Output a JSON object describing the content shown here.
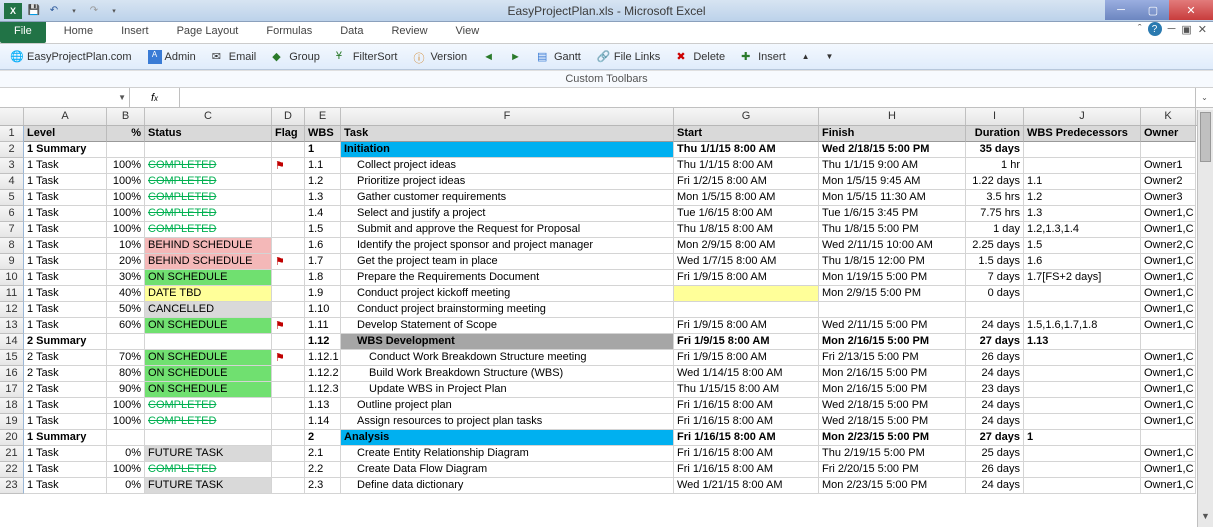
{
  "window": {
    "title": "EasyProjectPlan.xls  -  Microsoft Excel"
  },
  "ribbon": {
    "tabs": [
      "File",
      "Home",
      "Insert",
      "Page Layout",
      "Formulas",
      "Data",
      "Review",
      "View"
    ]
  },
  "toolbar": {
    "site": "EasyProjectPlan.com",
    "items": [
      "Admin",
      "Email",
      "Group",
      "FilterSort",
      "Version",
      "Gantt",
      "File Links",
      "Delete",
      "Insert"
    ],
    "label": "Custom Toolbars"
  },
  "namebox": "",
  "columns": [
    {
      "letter": "A",
      "cls": "cA"
    },
    {
      "letter": "B",
      "cls": "cB"
    },
    {
      "letter": "C",
      "cls": "cC"
    },
    {
      "letter": "D",
      "cls": "cD"
    },
    {
      "letter": "E",
      "cls": "cE"
    },
    {
      "letter": "F",
      "cls": "cF"
    },
    {
      "letter": "G",
      "cls": "cG"
    },
    {
      "letter": "H",
      "cls": "cH"
    },
    {
      "letter": "I",
      "cls": "cI"
    },
    {
      "letter": "J",
      "cls": "cJ"
    },
    {
      "letter": "K",
      "cls": "cK"
    }
  ],
  "headers": {
    "A": "Level",
    "B": "%",
    "C": "Status",
    "D": "Flag",
    "E": "WBS",
    "F": "Task",
    "G": "Start",
    "H": "Finish",
    "I": "Duration",
    "J": "WBS Predecessors",
    "K": "Owner"
  },
  "rows": [
    {
      "n": 2,
      "A": "1 Summary",
      "B": "",
      "C": "",
      "D": "",
      "E": "1",
      "F": "Initiation",
      "G": "Thu 1/1/15 8:00 AM",
      "H": "Wed 2/18/15 5:00 PM",
      "I": "35 days",
      "J": "",
      "K": "",
      "cls": "summary-row hl-initiation bold-dates"
    },
    {
      "n": 3,
      "A": "1 Task",
      "B": "100%",
      "C": "COMPLETED",
      "D": "flag",
      "E": "1.1",
      "F": "Collect project ideas",
      "G": "Thu 1/1/15 8:00 AM",
      "H": "Thu 1/1/15 9:00 AM",
      "I": "1 hr",
      "J": "",
      "K": "Owner1",
      "indent": 1,
      "status": "completed"
    },
    {
      "n": 4,
      "A": "1 Task",
      "B": "100%",
      "C": "COMPLETED",
      "D": "",
      "E": "1.2",
      "F": "Prioritize project ideas",
      "G": "Fri 1/2/15 8:00 AM",
      "H": "Mon 1/5/15 9:45 AM",
      "I": "1.22 days",
      "J": "1.1",
      "K": "Owner2",
      "indent": 1,
      "status": "completed"
    },
    {
      "n": 5,
      "A": "1 Task",
      "B": "100%",
      "C": "COMPLETED",
      "D": "",
      "E": "1.3",
      "F": "Gather customer requirements",
      "G": "Mon 1/5/15 8:00 AM",
      "H": "Mon 1/5/15 11:30 AM",
      "I": "3.5 hrs",
      "J": "1.2",
      "K": "Owner3",
      "indent": 1,
      "status": "completed"
    },
    {
      "n": 6,
      "A": "1 Task",
      "B": "100%",
      "C": "COMPLETED",
      "D": "",
      "E": "1.4",
      "F": "Select and justify a project",
      "G": "Tue 1/6/15 8:00 AM",
      "H": "Tue 1/6/15 3:45 PM",
      "I": "7.75 hrs",
      "J": "1.3",
      "K": "Owner1,C",
      "indent": 1,
      "status": "completed"
    },
    {
      "n": 7,
      "A": "1 Task",
      "B": "100%",
      "C": "COMPLETED",
      "D": "",
      "E": "1.5",
      "F": "Submit and approve the Request for Proposal",
      "G": "Thu 1/8/15 8:00 AM",
      "H": "Thu 1/8/15 5:00 PM",
      "I": "1 day",
      "J": "1.2,1.3,1.4",
      "K": "Owner1,C",
      "indent": 1,
      "status": "completed"
    },
    {
      "n": 8,
      "A": "1 Task",
      "B": "10%",
      "C": "BEHIND SCHEDULE",
      "D": "",
      "E": "1.6",
      "F": "Identify the project sponsor and project manager",
      "G": "Mon 2/9/15 8:00 AM",
      "H": "Wed 2/11/15 10:00 AM",
      "I": "2.25 days",
      "J": "1.5",
      "K": "Owner2,C",
      "indent": 1,
      "status": "behind"
    },
    {
      "n": 9,
      "A": "1 Task",
      "B": "20%",
      "C": "BEHIND SCHEDULE",
      "D": "flag",
      "E": "1.7",
      "F": "Get the project team in place",
      "G": "Wed 1/7/15 8:00 AM",
      "H": "Thu 1/8/15 12:00 PM",
      "I": "1.5 days",
      "J": "1.6",
      "K": "Owner1,C",
      "indent": 1,
      "status": "behind"
    },
    {
      "n": 10,
      "A": "1 Task",
      "B": "30%",
      "C": "ON SCHEDULE",
      "D": "",
      "E": "1.8",
      "F": "Prepare the Requirements Document",
      "G": "Fri 1/9/15 8:00 AM",
      "H": "Mon 1/19/15 5:00 PM",
      "I": "7 days",
      "J": "1.7[FS+2 days]",
      "K": "Owner1,C",
      "indent": 1,
      "status": "onsched"
    },
    {
      "n": 11,
      "A": "1 Task",
      "B": "40%",
      "C": "DATE TBD",
      "D": "",
      "E": "1.9",
      "F": "Conduct project kickoff meeting",
      "G": "",
      "H": "Mon 2/9/15 5:00 PM",
      "I": "0 days",
      "J": "",
      "K": "Owner1,C",
      "indent": 1,
      "status": "datetbd",
      "startYellow": true
    },
    {
      "n": 12,
      "A": "1 Task",
      "B": "50%",
      "C": "CANCELLED",
      "D": "",
      "E": "1.10",
      "F": "Conduct project brainstorming meeting",
      "G": "",
      "H": "",
      "I": "",
      "J": "",
      "K": "Owner1,C",
      "indent": 1,
      "status": "cancelled"
    },
    {
      "n": 13,
      "A": "1 Task",
      "B": "60%",
      "C": "ON SCHEDULE",
      "D": "flag",
      "E": "1.11",
      "F": "Develop Statement of Scope",
      "G": "Fri 1/9/15 8:00 AM",
      "H": "Wed 2/11/15 5:00 PM",
      "I": "24 days",
      "J": "1.5,1.6,1.7,1.8",
      "K": "Owner1,C",
      "indent": 1,
      "status": "onsched"
    },
    {
      "n": 14,
      "A": "2 Summary",
      "B": "",
      "C": "",
      "D": "",
      "E": "1.12",
      "F": "WBS Development",
      "G": "Fri 1/9/15 8:00 AM",
      "H": "Mon 2/16/15 5:00 PM",
      "I": "27 days",
      "J": "1.13",
      "K": "",
      "cls": "summary-row hl-wbs bold-dates",
      "findent": 1
    },
    {
      "n": 15,
      "A": "2 Task",
      "B": "70%",
      "C": "ON SCHEDULE",
      "D": "flag",
      "E": "1.12.1",
      "F": "Conduct Work Breakdown Structure meeting",
      "G": "Fri 1/9/15 8:00 AM",
      "H": "Fri 2/13/15 5:00 PM",
      "I": "26 days",
      "J": "",
      "K": "Owner1,C",
      "indent": 2,
      "status": "onsched"
    },
    {
      "n": 16,
      "A": "2 Task",
      "B": "80%",
      "C": "ON SCHEDULE",
      "D": "",
      "E": "1.12.2",
      "F": "Build Work Breakdown Structure (WBS)",
      "G": "Wed 1/14/15 8:00 AM",
      "H": "Mon 2/16/15 5:00 PM",
      "I": "24 days",
      "J": "",
      "K": "Owner1,C",
      "indent": 2,
      "status": "onsched"
    },
    {
      "n": 17,
      "A": "2 Task",
      "B": "90%",
      "C": "ON SCHEDULE",
      "D": "",
      "E": "1.12.3",
      "F": "Update WBS in Project Plan",
      "G": "Thu 1/15/15 8:00 AM",
      "H": "Mon 2/16/15 5:00 PM",
      "I": "23 days",
      "J": "",
      "K": "Owner1,C",
      "indent": 2,
      "status": "onsched"
    },
    {
      "n": 18,
      "A": "1 Task",
      "B": "100%",
      "C": "COMPLETED",
      "D": "",
      "E": "1.13",
      "F": "Outline project plan",
      "G": "Fri 1/16/15 8:00 AM",
      "H": "Wed 2/18/15 5:00 PM",
      "I": "24 days",
      "J": "",
      "K": "Owner1,C",
      "indent": 1,
      "status": "completed"
    },
    {
      "n": 19,
      "A": "1 Task",
      "B": "100%",
      "C": "COMPLETED",
      "D": "",
      "E": "1.14",
      "F": "Assign resources to project plan tasks",
      "G": "Fri 1/16/15 8:00 AM",
      "H": "Wed 2/18/15 5:00 PM",
      "I": "24 days",
      "J": "",
      "K": "Owner1,C",
      "indent": 1,
      "status": "completed"
    },
    {
      "n": 20,
      "A": "1 Summary",
      "B": "",
      "C": "",
      "D": "",
      "E": "2",
      "F": "Analysis",
      "G": "Fri 1/16/15 8:00 AM",
      "H": "Mon 2/23/15 5:00 PM",
      "I": "27 days",
      "J": "1",
      "K": "",
      "cls": "summary-row hl-analysis bold-dates"
    },
    {
      "n": 21,
      "A": "1 Task",
      "B": "0%",
      "C": "FUTURE TASK",
      "D": "",
      "E": "2.1",
      "F": "Create Entity Relationship Diagram",
      "G": "Fri 1/16/15 8:00 AM",
      "H": "Thu 2/19/15 5:00 PM",
      "I": "25 days",
      "J": "",
      "K": "Owner1,C",
      "indent": 1,
      "status": "future"
    },
    {
      "n": 22,
      "A": "1 Task",
      "B": "100%",
      "C": "COMPLETED",
      "D": "",
      "E": "2.2",
      "F": "Create Data Flow Diagram",
      "G": "Fri 1/16/15 8:00 AM",
      "H": "Fri 2/20/15 5:00 PM",
      "I": "26 days",
      "J": "",
      "K": "Owner1,C",
      "indent": 1,
      "status": "completed"
    },
    {
      "n": 23,
      "A": "1 Task",
      "B": "0%",
      "C": "FUTURE TASK",
      "D": "",
      "E": "2.3",
      "F": "Define data dictionary",
      "G": "Wed 1/21/15 8:00 AM",
      "H": "Mon 2/23/15 5:00 PM",
      "I": "24 days",
      "J": "",
      "K": "Owner1,C",
      "indent": 1,
      "status": "future"
    }
  ]
}
